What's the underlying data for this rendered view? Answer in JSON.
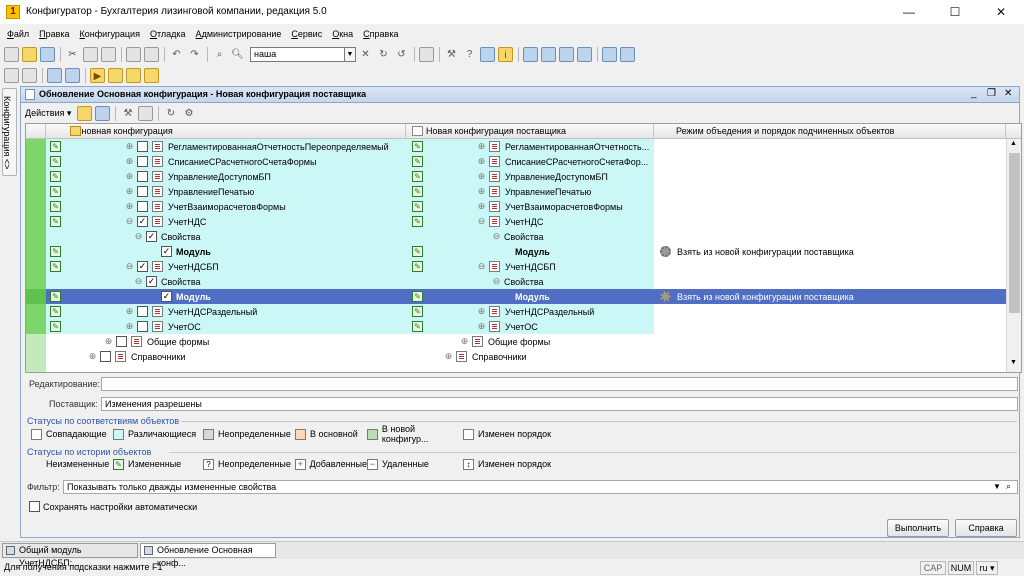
{
  "window": {
    "title": "Конфигуратор - Бухгалтерия лизинговой компании, редакция 5.0",
    "minimize": "—",
    "maximize": "☐",
    "close": "✕"
  },
  "menu": [
    "Файл",
    "Правка",
    "Конфигурация",
    "Отладка",
    "Администрирование",
    "Сервис",
    "Окна",
    "Справка"
  ],
  "toolbar": {
    "search_value": "наша"
  },
  "side_tab": "Конфигурация <>",
  "inner_window": {
    "title": "Обновление Основная конфигурация - Новая конфигурация поставщика",
    "actions_label": "Действия ▾"
  },
  "tree": {
    "columns": [
      "Основная конфигурация",
      "Новая конфигурация поставщика",
      "Режим объедения и порядок подчиненных объектов"
    ],
    "rows": [
      {
        "left": "РегламентированнаяОтчетностьПереопределяемый",
        "right": "РегламентированнаяОтчетность...",
        "mode": ""
      },
      {
        "left": "СписаниеСРасчетногоСчетаФормы",
        "right": "СписаниеСРасчетногоСчетаФор...",
        "mode": ""
      },
      {
        "left": "УправлениеДоступомБП",
        "right": "УправлениеДоступомБП",
        "mode": ""
      },
      {
        "left": "УправлениеПечатью",
        "right": "УправлениеПечатью",
        "mode": ""
      },
      {
        "left": "УчетВзаиморасчетовФормы",
        "right": "УчетВзаиморасчетовФормы",
        "mode": ""
      },
      {
        "left": "УчетНДС",
        "right": "УчетНДС",
        "mode": ""
      },
      {
        "left": "Свойства",
        "right": "Свойства",
        "mode": ""
      },
      {
        "left": "Модуль",
        "right": "Модуль",
        "mode": "Взять из новой конфигурации поставщика"
      },
      {
        "left": "УчетНДСБП",
        "right": "УчетНДСБП",
        "mode": ""
      },
      {
        "left": "Свойства",
        "right": "Свойства",
        "mode": ""
      },
      {
        "left": "Модуль",
        "right": "Модуль",
        "mode": "Взять из новой конфигурации поставщика"
      },
      {
        "left": "УчетНДСРаздельный",
        "right": "УчетНДСРаздельный",
        "mode": ""
      },
      {
        "left": "УчетОС",
        "right": "УчетОС",
        "mode": ""
      },
      {
        "left": "Общие формы",
        "right": "Общие формы",
        "mode": ""
      },
      {
        "left": "Справочники",
        "right": "Справочники",
        "mode": ""
      }
    ]
  },
  "fields": {
    "edit_label": "Редактирование:",
    "edit_value": "",
    "supplier_label": "Поставщик:",
    "supplier_value": "Изменения разрешены",
    "filter_label": "Фильтр:",
    "filter_value": "Показывать только дважды измененные свойства"
  },
  "status_match": {
    "title": "Статусы по соответствиям объектов",
    "items": [
      {
        "label": "Совпадающие",
        "color": "#ffffff"
      },
      {
        "label": "Различающиеся",
        "color": "#ccf7f7"
      },
      {
        "label": "Неопределенные",
        "color": "#d8d8d8"
      },
      {
        "label": "В основной",
        "color": "#fad8b8"
      },
      {
        "label": "В новой конфигур...",
        "color": "#b7dfb0"
      },
      {
        "label": "Изменен порядок",
        "color": "#ffffff"
      }
    ]
  },
  "status_history": {
    "title": "Статусы по истории объектов",
    "items": [
      {
        "label": "Неизмененные",
        "icon": "blank-icon"
      },
      {
        "label": "Измененные",
        "icon": "pencil-icon"
      },
      {
        "label": "Неопределенные",
        "icon": "question-icon"
      },
      {
        "label": "Добавленные",
        "icon": "plus-icon"
      },
      {
        "label": "Удаленные",
        "icon": "minus-icon"
      },
      {
        "label": "Изменен порядок",
        "icon": "order-icon"
      }
    ]
  },
  "checkbox_save": "Сохранять настройки автоматически",
  "buttons": {
    "run": "Выполнить",
    "help": "Справка"
  },
  "taskbar": [
    {
      "label": "Общий модуль УчетНДСБП:...",
      "active": false
    },
    {
      "label": "Обновление Основная конф...",
      "active": true
    }
  ],
  "statusbar": {
    "hint": "Для получения подсказки нажмите F1",
    "cap": "CAP",
    "num": "NUM",
    "lang": "ru ▾"
  }
}
